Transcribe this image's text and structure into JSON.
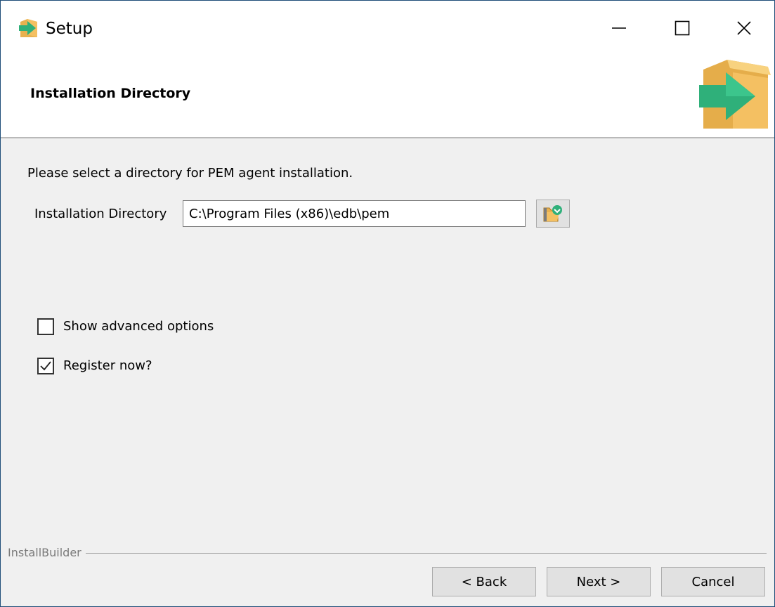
{
  "window": {
    "title": "Setup",
    "icon": "setup-box-arrow-icon",
    "controls": [
      "minimize-icon",
      "maximize-icon",
      "close-icon"
    ]
  },
  "header": {
    "title": "Installation Directory",
    "logo": "box-green-arrow-icon"
  },
  "body": {
    "prompt": "Please select a directory for PEM agent installation.",
    "directory_label": "Installation Directory",
    "directory_value": "C:\\Program Files (x86)\\edb\\pem",
    "browse_icon": "folder-browse-icon",
    "options": [
      {
        "label": "Show advanced options",
        "checked": false
      },
      {
        "label": "Register now?",
        "checked": true
      }
    ]
  },
  "footer": {
    "brand": "InstallBuilder",
    "back_label": "< Back",
    "next_label": "Next >",
    "cancel_label": "Cancel"
  },
  "colors": {
    "window_border": "#1f4e79",
    "body_bg": "#f0f0f0",
    "logo_green": "#2fb07a",
    "logo_box": "#f4c062"
  }
}
